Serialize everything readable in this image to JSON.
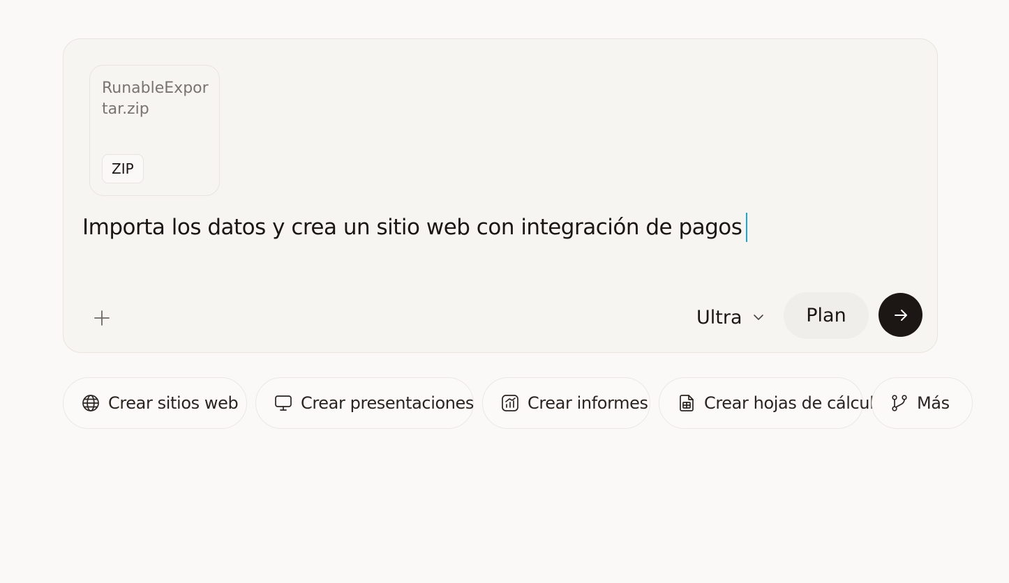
{
  "composer": {
    "attachment": {
      "file_name": "RunableExportar.zip",
      "file_type": "ZIP"
    },
    "prompt_text": "Importa los datos y crea un sitio web con integración de pagos",
    "add_icon": "plus-icon",
    "model": {
      "label": "Ultra",
      "icon": "chevron-down-icon"
    },
    "plan_label": "Plan",
    "send_icon": "arrow-right-icon"
  },
  "quick_actions": [
    {
      "label": "Crear sitios web",
      "icon": "globe-icon"
    },
    {
      "label": "Crear presentaciones",
      "icon": "presentation-icon"
    },
    {
      "label": "Crear informes",
      "icon": "chart-report-icon"
    },
    {
      "label": "Crear hojas de cálculo",
      "icon": "spreadsheet-icon"
    },
    {
      "label": "Más",
      "icon": "git-branch-icon"
    }
  ],
  "colors": {
    "background": "#faf9f7",
    "composer_bg": "#f7f5f2",
    "send_button": "#1c1614",
    "caret": "#1aa6d6",
    "text": "#1a1614"
  }
}
